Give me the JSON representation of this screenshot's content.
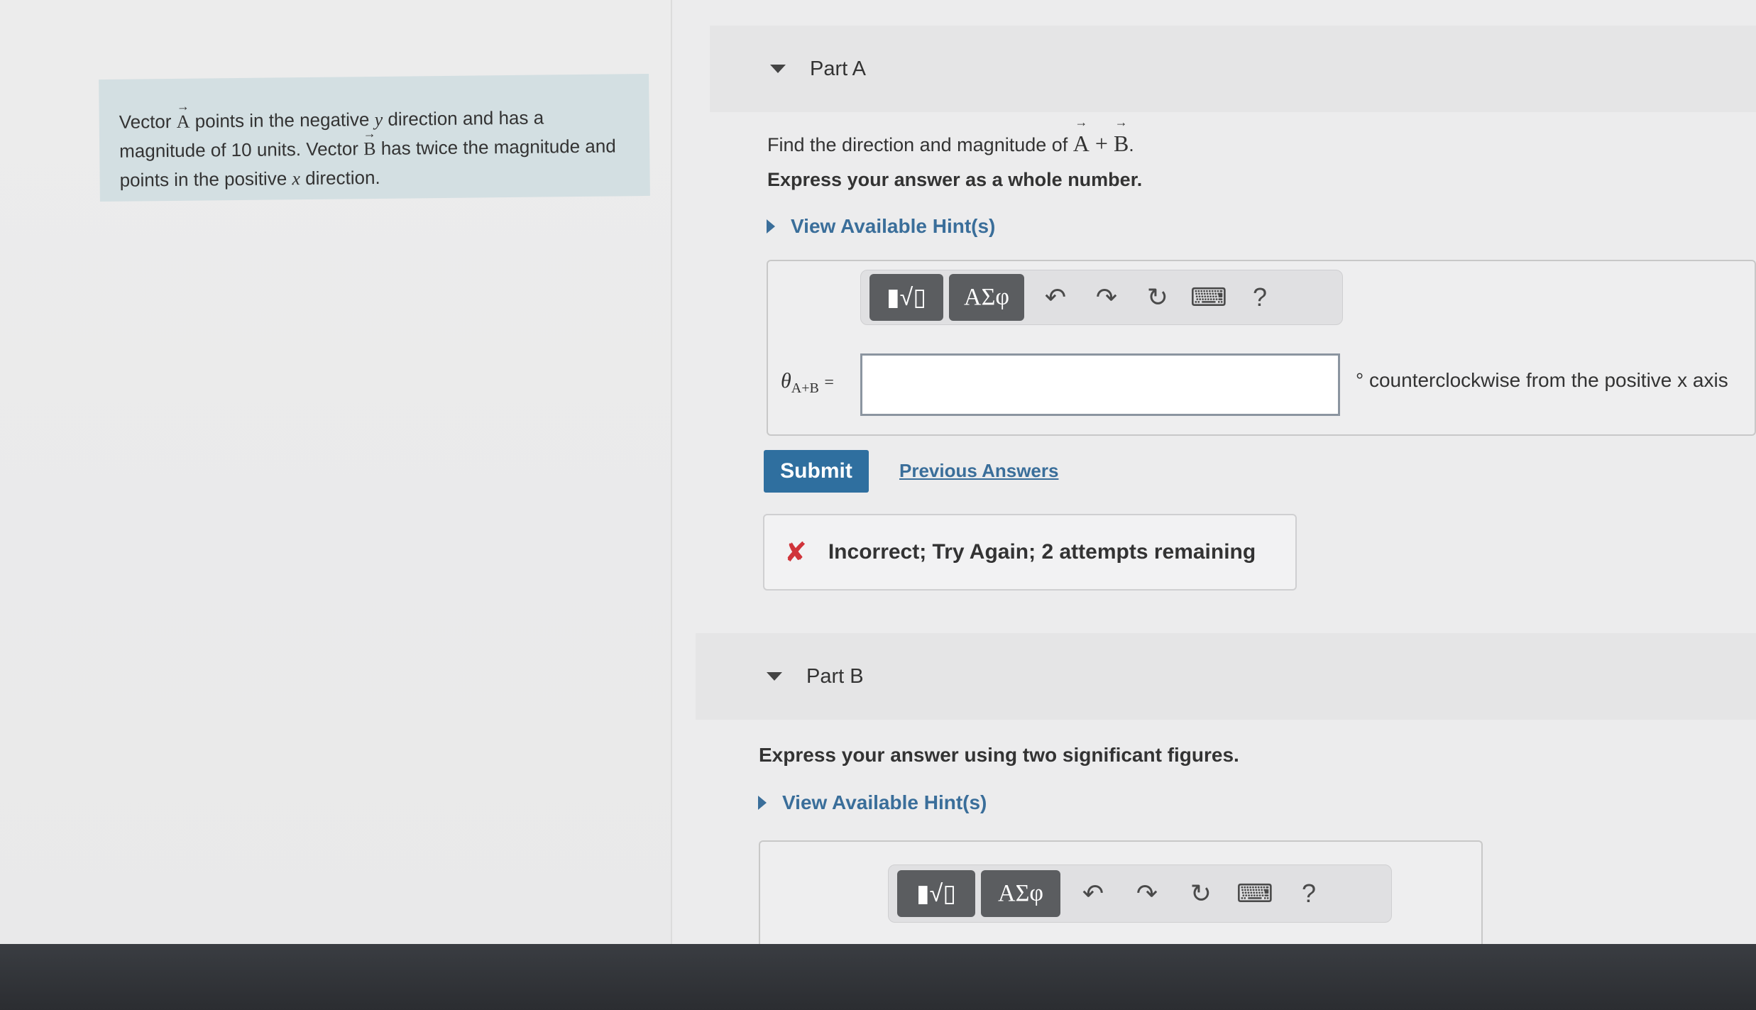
{
  "problem": {
    "t1": "Vector ",
    "vecA": "A",
    "t2": " points in the negative ",
    "y": "y",
    "t3": " direction and has a magnitude of 10 units. Vector ",
    "vecB": "B",
    "t4": " has twice the magnitude and points in the positive ",
    "x": "x",
    "t5": " direction."
  },
  "partA": {
    "title": "Part A",
    "question_prefix": "Find the direction and magnitude of ",
    "question_expr_a": "A",
    "question_plus": " + ",
    "question_expr_b": "B",
    "question_end": ".",
    "instruction": "Express your answer as a whole number.",
    "hint_label": "View Available Hint(s)",
    "toolbar": {
      "templates": "▮√▯",
      "greek": "ΑΣφ",
      "undo": "↶",
      "redo": "↷",
      "reset": "↻",
      "keyboard": "⌨",
      "help": "?"
    },
    "var_label": "θ",
    "var_sub": "A+B",
    "equals": "=",
    "input_value": "",
    "unit_text": "° counterclockwise from the positive x axis",
    "submit_label": "Submit",
    "previous_answers": "Previous Answers",
    "feedback": "Incorrect; Try Again; 2 attempts remaining",
    "feedback_icon": "✘"
  },
  "partB": {
    "title": "Part B",
    "instruction": "Express your answer using two significant figures.",
    "hint_label": "View Available Hint(s)",
    "toolbar": {
      "templates": "▮√▯",
      "greek": "ΑΣφ",
      "undo": "↶",
      "redo": "↷",
      "reset": "↻",
      "keyboard": "⌨",
      "help": "?"
    }
  }
}
